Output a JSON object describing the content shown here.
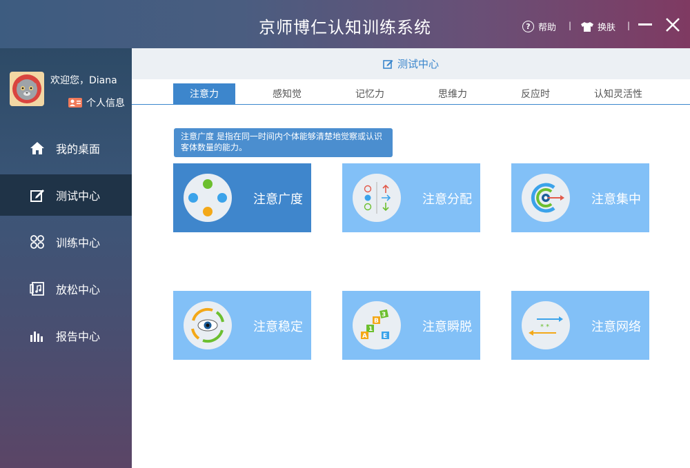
{
  "window": {
    "title": "京师博仁认知训练系统",
    "help_label": "帮助",
    "skin_label": "换肤",
    "separator": "|"
  },
  "user": {
    "welcome": "欢迎您，Diana",
    "profile_label": "个人信息"
  },
  "sidebar": {
    "items": [
      {
        "label": "我的桌面",
        "icon": "home-icon",
        "active": false
      },
      {
        "label": "测试中心",
        "icon": "edit-icon",
        "active": true
      },
      {
        "label": "训练中心",
        "icon": "grid-icon",
        "active": false
      },
      {
        "label": "放松中心",
        "icon": "music-icon",
        "active": false
      },
      {
        "label": "报告中心",
        "icon": "bar-chart-icon",
        "active": false
      }
    ]
  },
  "main": {
    "header": "测试中心",
    "tabs": [
      {
        "label": "注意力",
        "active": true
      },
      {
        "label": "感知觉",
        "active": false
      },
      {
        "label": "记忆力",
        "active": false
      },
      {
        "label": "思维力",
        "active": false
      },
      {
        "label": "反应时",
        "active": false
      },
      {
        "label": "认知灵活性",
        "active": false
      }
    ],
    "tooltip": "注意广度 是指在同一时间内个体能够清楚地觉察或认识客体数量的能力。",
    "cards": [
      {
        "label": "注意广度",
        "icon": "dots-circle-icon",
        "active": true
      },
      {
        "label": "注意分配",
        "icon": "split-attention-icon",
        "active": false
      },
      {
        "label": "注意集中",
        "icon": "target-icon",
        "active": false
      },
      {
        "label": "注意稳定",
        "icon": "eye-cycle-icon",
        "active": false
      },
      {
        "label": "注意瞬脱",
        "icon": "letter-blocks-icon",
        "active": false
      },
      {
        "label": "注意网络",
        "icon": "arrows-network-icon",
        "active": false
      }
    ]
  },
  "colors": {
    "accent": "#3d86cc",
    "card": "#82c0f7",
    "card_active": "#3f86cc",
    "sidebar_active": "#1f3347"
  }
}
